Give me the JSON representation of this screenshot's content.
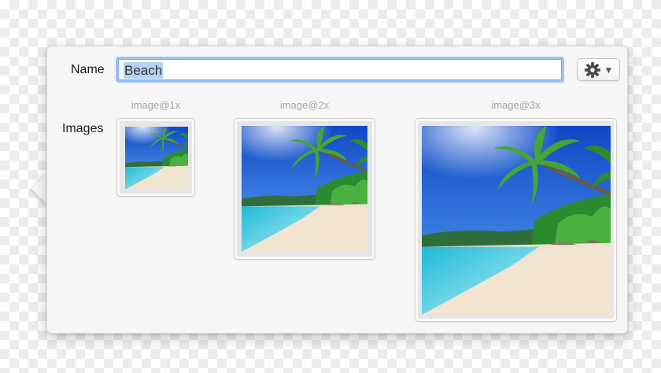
{
  "name_label": "Name",
  "name_value": "Beach",
  "images_label": "Images",
  "settings_icon": "gear-icon",
  "dropdown_icon": "triangle-down-icon",
  "slots": [
    {
      "scale": "image@1x"
    },
    {
      "scale": "image@2x"
    },
    {
      "scale": "image@3x"
    }
  ],
  "colors": {
    "sky": "#1e5fd0",
    "sea": "#4fd3e6",
    "sand": "#efe3cf",
    "palm": "#3fa53a",
    "focus_ring": "#9dc2f2"
  }
}
